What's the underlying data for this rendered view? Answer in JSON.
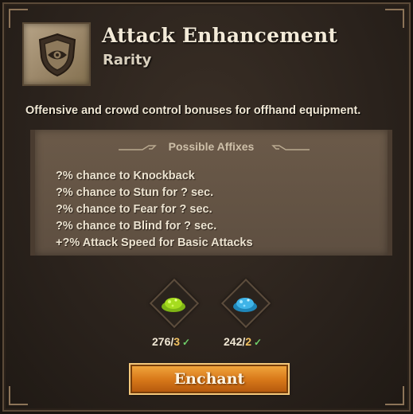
{
  "item": {
    "icon": "shield-eye-icon",
    "title": "Attack Enhancement",
    "subtitle": "Rarity"
  },
  "description": "Offensive and crowd control bonuses for offhand equipment.",
  "affixes": {
    "header": "Possible Affixes",
    "items": [
      "?% chance to Knockback",
      "?% chance to Stun for  ? sec.",
      "?% chance to Fear for  ? sec.",
      "?% chance to Blind for  ? sec.",
      "+?% Attack Speed for Basic Attacks"
    ]
  },
  "materials": [
    {
      "icon": "green-dust-icon",
      "color": "#9fd21a",
      "have": "276",
      "need": "3",
      "separator": "/"
    },
    {
      "icon": "blue-dust-icon",
      "color": "#3fb4e8",
      "have": "242",
      "need": "2",
      "separator": "/"
    }
  ],
  "enchant_button": {
    "label": "Enchant"
  },
  "colors": {
    "frame": "#2a221c",
    "panel": "#6b5a49",
    "accent_button": "#d97a1a",
    "check": "#6fd06a"
  }
}
